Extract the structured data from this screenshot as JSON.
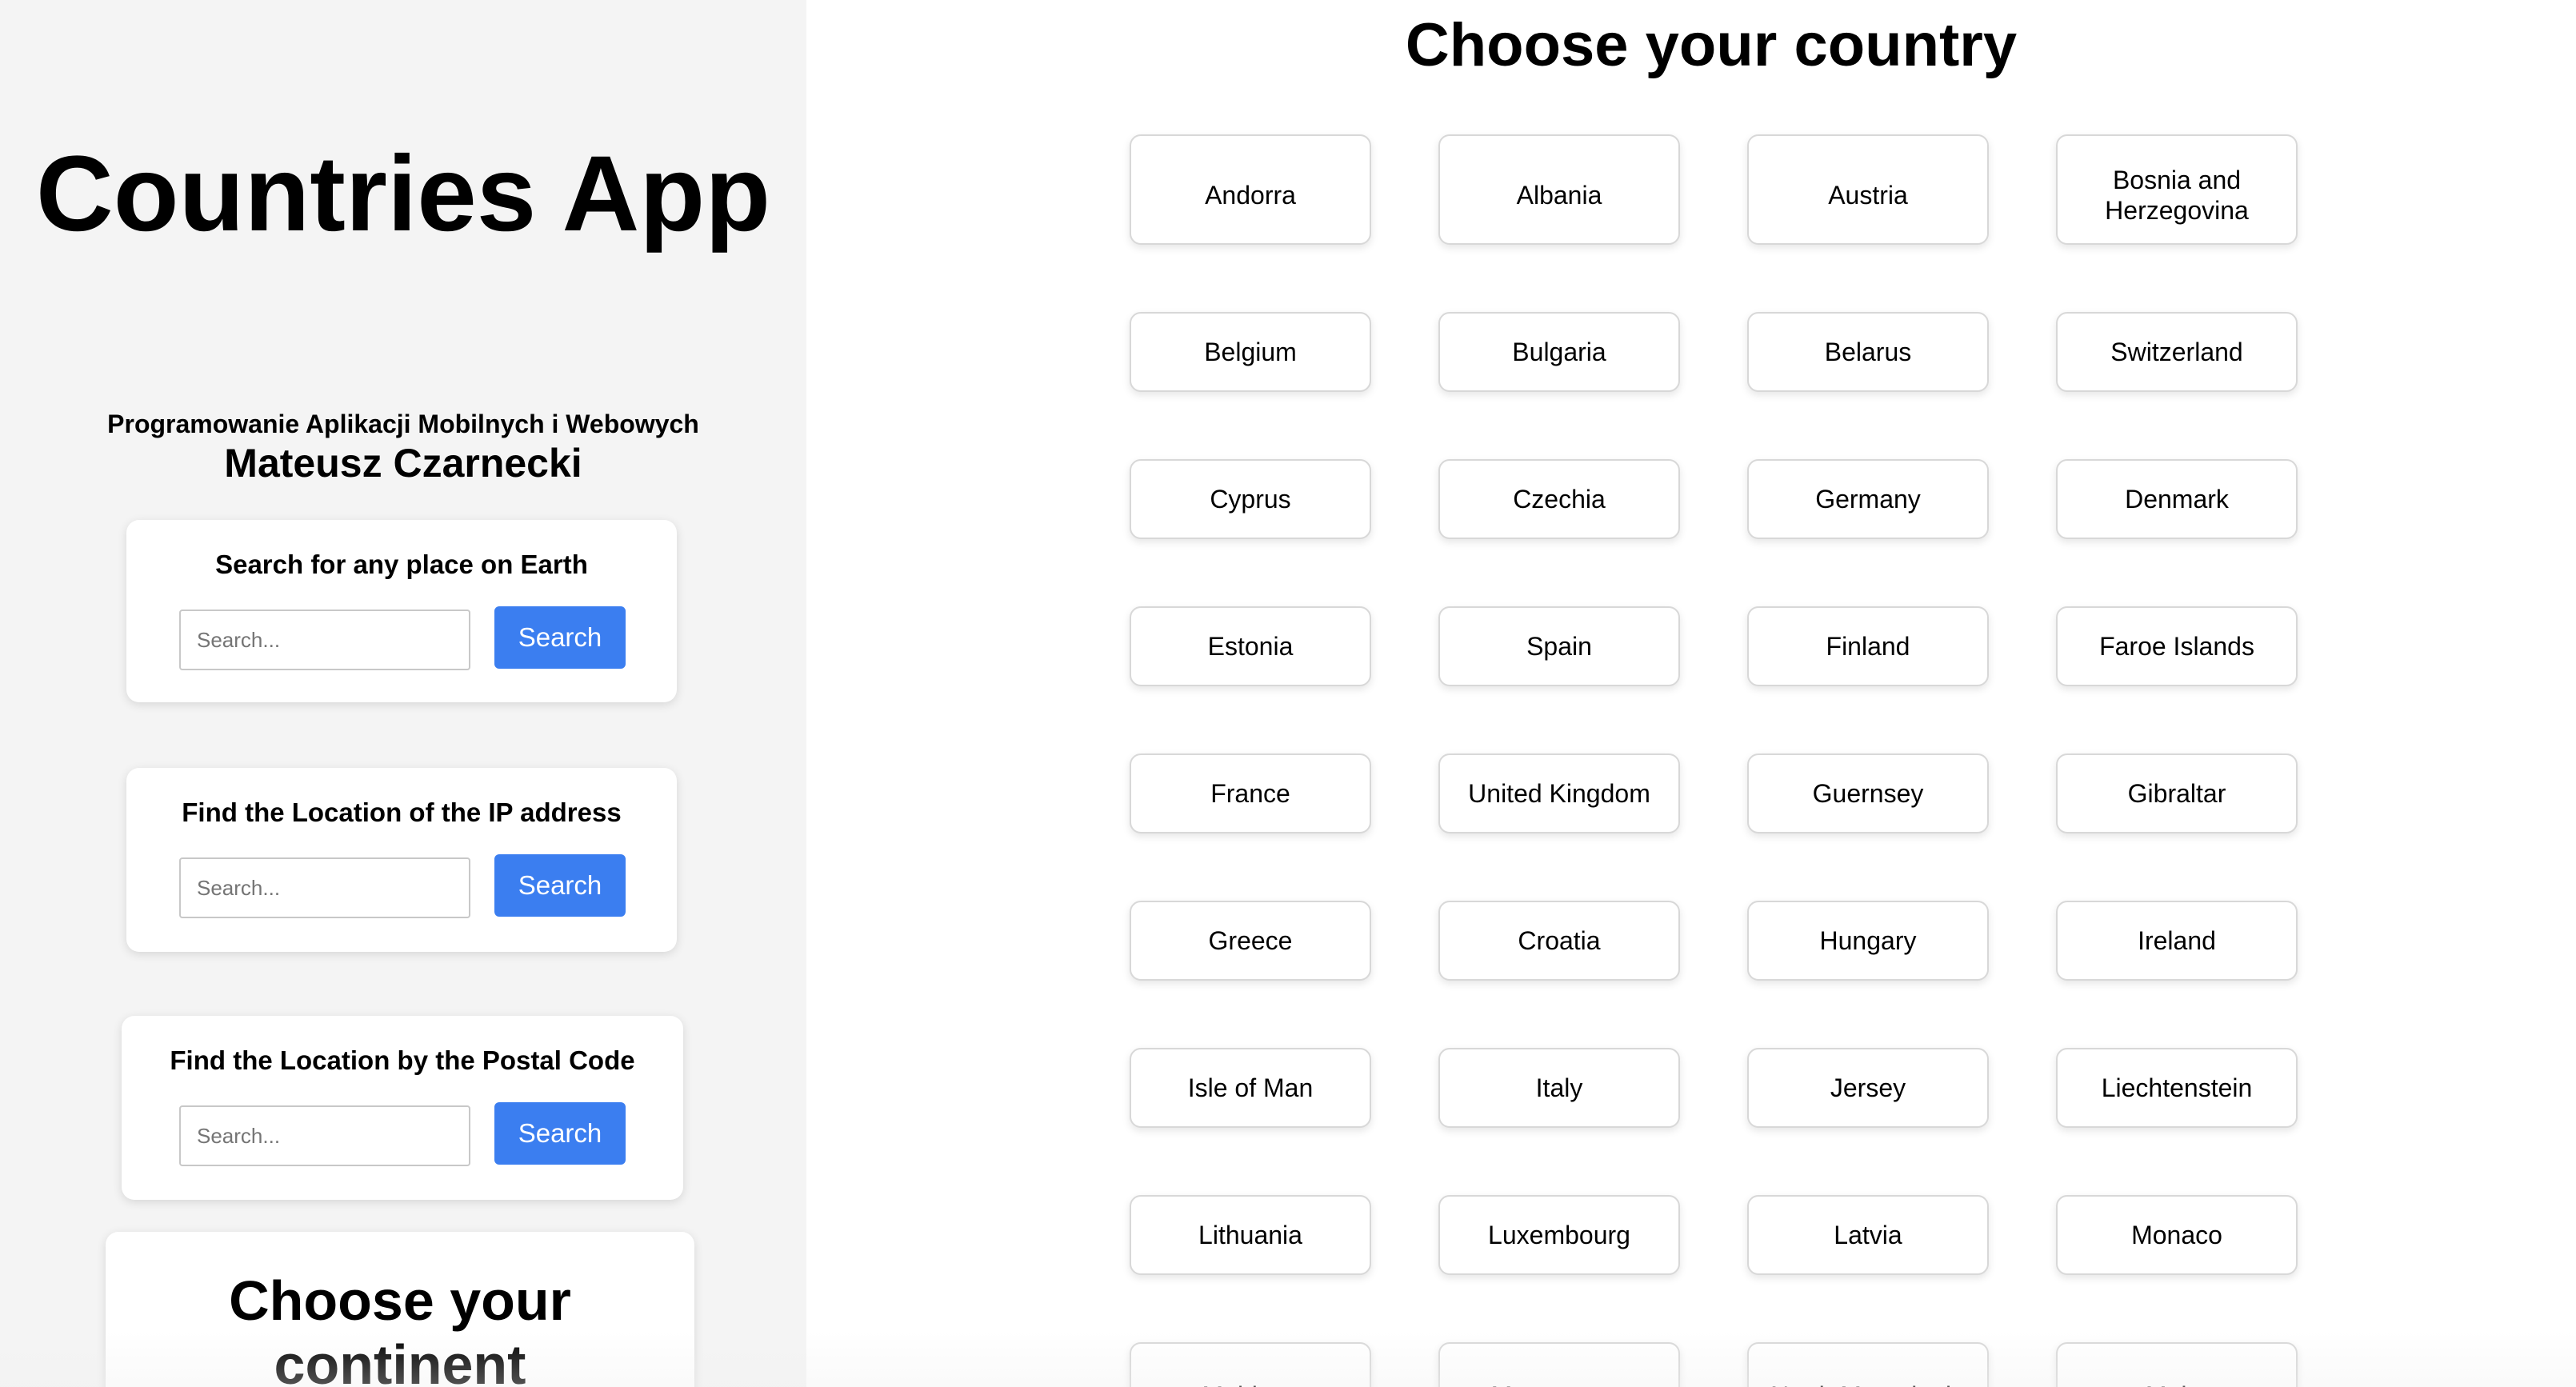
{
  "sidebar": {
    "app_title": "Countries App",
    "subtitle": "Programowanie Aplikacji Mobilnych i Webowych",
    "author": "Mateusz Czarnecki",
    "place_search": {
      "title": "Search for any place on Earth",
      "placeholder": "Search...",
      "button": "Search"
    },
    "ip_search": {
      "title": "Find the Location of the IP address",
      "placeholder": "Search...",
      "button": "Search"
    },
    "postal_search": {
      "title": "Find the Location by the Postal Code",
      "placeholder": "Search...",
      "button": "Search"
    },
    "continent_title": "Choose your continent"
  },
  "main": {
    "title": "Choose your country",
    "countries": [
      "Andorra",
      "Albania",
      "Austria",
      "Bosnia and Herzegovina",
      "Belgium",
      "Bulgaria",
      "Belarus",
      "Switzerland",
      "Cyprus",
      "Czechia",
      "Germany",
      "Denmark",
      "Estonia",
      "Spain",
      "Finland",
      "Faroe Islands",
      "France",
      "United Kingdom",
      "Guernsey",
      "Gibraltar",
      "Greece",
      "Croatia",
      "Hungary",
      "Ireland",
      "Isle of Man",
      "Italy",
      "Jersey",
      "Liechtenstein",
      "Lithuania",
      "Luxembourg",
      "Latvia",
      "Monaco",
      "Moldova",
      "Montenegro",
      "North Macedonia",
      "Malta"
    ]
  },
  "colors": {
    "accent": "#3b7ef0",
    "sidebar_bg": "#f4f4f4"
  }
}
